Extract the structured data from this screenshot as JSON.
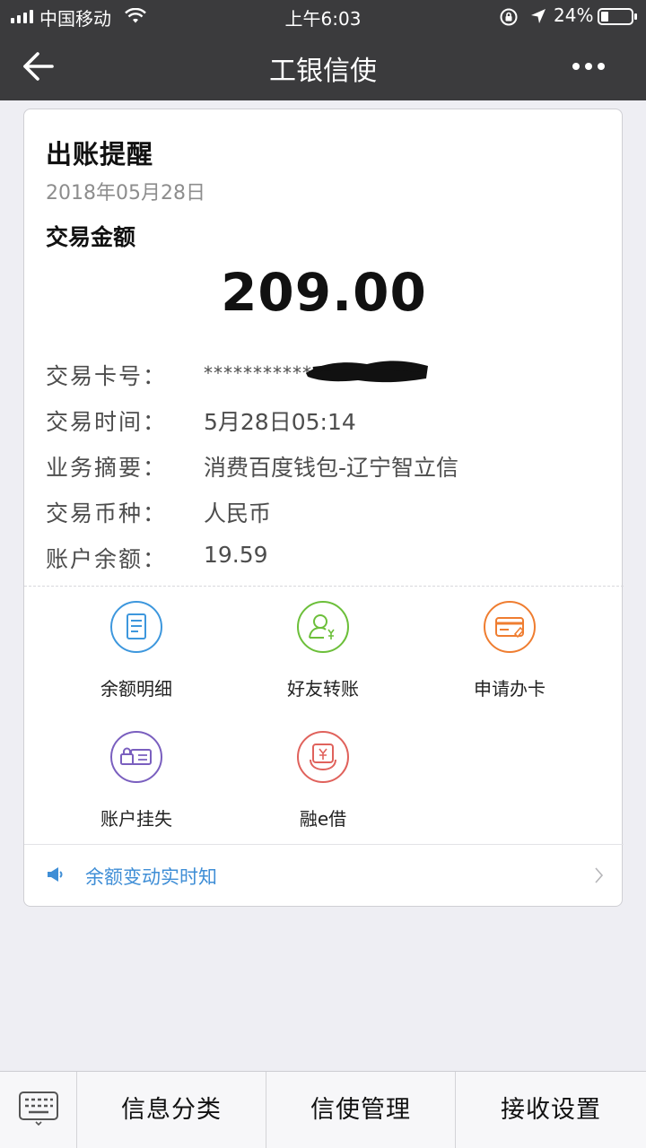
{
  "status_bar": {
    "carrier": "中国移动",
    "time": "上午6:03",
    "battery_pct": "24%",
    "battery_level": 0.24,
    "icons": [
      "signal-icon",
      "wifi-icon",
      "rotation-lock-icon",
      "location-arrow-icon",
      "battery-icon"
    ]
  },
  "nav": {
    "title": "工银信使",
    "back_icon": "back-arrow-icon",
    "more_icon": "more-dots-icon"
  },
  "message": {
    "title": "出账提醒",
    "date": "2018年05月28日",
    "amount_label": "交易金额",
    "amount": "209.00",
    "details": [
      {
        "key": "交易卡号：",
        "value": "***********"
      },
      {
        "key": "交易时间：",
        "value": "5月28日05:14"
      },
      {
        "key": "业务摘要：",
        "value": "消费百度钱包-辽宁智立信"
      },
      {
        "key": "交易币种：",
        "value": "人民币"
      },
      {
        "key": "账户余额：",
        "value": "19.59"
      }
    ]
  },
  "actions": [
    {
      "label": "余额明细",
      "icon": "document-icon",
      "color": "#3d97dd"
    },
    {
      "label": "好友转账",
      "icon": "user-transfer-icon",
      "color": "#6cbf3a"
    },
    {
      "label": "申请办卡",
      "icon": "card-apply-icon",
      "color": "#ef7d30"
    },
    {
      "label": "账户挂失",
      "icon": "lock-card-icon",
      "color": "#7a5fbf"
    },
    {
      "label": "融e借",
      "icon": "loan-icon",
      "color": "#e0625c"
    }
  ],
  "notice": {
    "text": "余额变动实时知",
    "icon": "megaphone-icon",
    "chevron_icon": "chevron-right-icon",
    "color": "#3f8ed6"
  },
  "bottom_bar": {
    "keyboard_icon": "keyboard-icon",
    "items": [
      "信息分类",
      "信使管理",
      "接收设置"
    ]
  }
}
